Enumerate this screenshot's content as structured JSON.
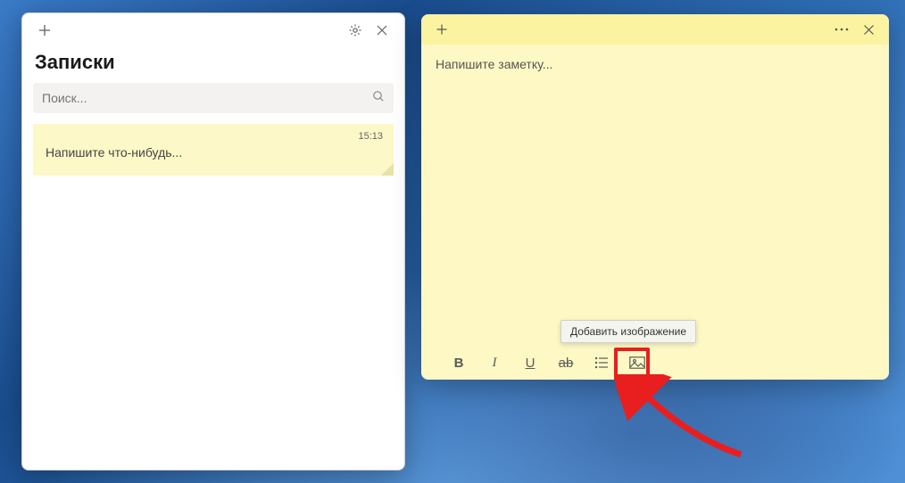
{
  "notes_window": {
    "title": "Записки",
    "search_placeholder": "Поиск...",
    "items": [
      {
        "time": "15:13",
        "preview": "Напишите что-нибудь..."
      }
    ]
  },
  "sticky_note": {
    "placeholder": "Напишите заметку...",
    "toolbar": {
      "bold": "B",
      "italic": "I",
      "underline": "U",
      "strike": "ab",
      "tooltip_add_image": "Добавить изображение"
    }
  },
  "icons": {
    "plus": "plus-icon",
    "gear": "gear-icon",
    "close": "close-icon",
    "menu": "menu-icon",
    "search": "search-icon",
    "bullets": "bullets-icon",
    "image": "image-icon"
  }
}
